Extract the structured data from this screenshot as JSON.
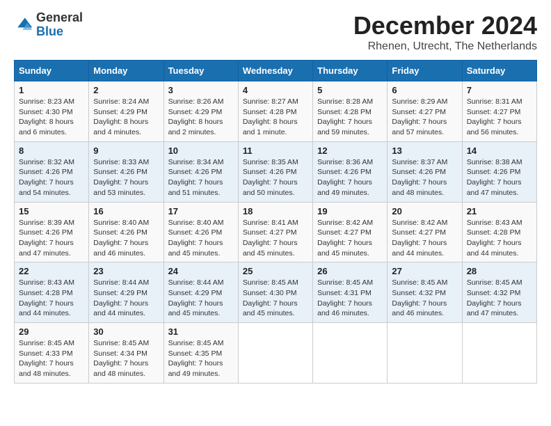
{
  "logo": {
    "text_general": "General",
    "text_blue": "Blue"
  },
  "title": "December 2024",
  "subtitle": "Rhenen, Utrecht, The Netherlands",
  "days_of_week": [
    "Sunday",
    "Monday",
    "Tuesday",
    "Wednesday",
    "Thursday",
    "Friday",
    "Saturday"
  ],
  "weeks": [
    [
      {
        "day": "1",
        "sunrise": "8:23 AM",
        "sunset": "4:30 PM",
        "daylight": "8 hours and 6 minutes."
      },
      {
        "day": "2",
        "sunrise": "8:24 AM",
        "sunset": "4:29 PM",
        "daylight": "8 hours and 4 minutes."
      },
      {
        "day": "3",
        "sunrise": "8:26 AM",
        "sunset": "4:29 PM",
        "daylight": "8 hours and 2 minutes."
      },
      {
        "day": "4",
        "sunrise": "8:27 AM",
        "sunset": "4:28 PM",
        "daylight": "8 hours and 1 minute."
      },
      {
        "day": "5",
        "sunrise": "8:28 AM",
        "sunset": "4:28 PM",
        "daylight": "7 hours and 59 minutes."
      },
      {
        "day": "6",
        "sunrise": "8:29 AM",
        "sunset": "4:27 PM",
        "daylight": "7 hours and 57 minutes."
      },
      {
        "day": "7",
        "sunrise": "8:31 AM",
        "sunset": "4:27 PM",
        "daylight": "7 hours and 56 minutes."
      }
    ],
    [
      {
        "day": "8",
        "sunrise": "8:32 AM",
        "sunset": "4:26 PM",
        "daylight": "7 hours and 54 minutes."
      },
      {
        "day": "9",
        "sunrise": "8:33 AM",
        "sunset": "4:26 PM",
        "daylight": "7 hours and 53 minutes."
      },
      {
        "day": "10",
        "sunrise": "8:34 AM",
        "sunset": "4:26 PM",
        "daylight": "7 hours and 51 minutes."
      },
      {
        "day": "11",
        "sunrise": "8:35 AM",
        "sunset": "4:26 PM",
        "daylight": "7 hours and 50 minutes."
      },
      {
        "day": "12",
        "sunrise": "8:36 AM",
        "sunset": "4:26 PM",
        "daylight": "7 hours and 49 minutes."
      },
      {
        "day": "13",
        "sunrise": "8:37 AM",
        "sunset": "4:26 PM",
        "daylight": "7 hours and 48 minutes."
      },
      {
        "day": "14",
        "sunrise": "8:38 AM",
        "sunset": "4:26 PM",
        "daylight": "7 hours and 47 minutes."
      }
    ],
    [
      {
        "day": "15",
        "sunrise": "8:39 AM",
        "sunset": "4:26 PM",
        "daylight": "7 hours and 47 minutes."
      },
      {
        "day": "16",
        "sunrise": "8:40 AM",
        "sunset": "4:26 PM",
        "daylight": "7 hours and 46 minutes."
      },
      {
        "day": "17",
        "sunrise": "8:40 AM",
        "sunset": "4:26 PM",
        "daylight": "7 hours and 45 minutes."
      },
      {
        "day": "18",
        "sunrise": "8:41 AM",
        "sunset": "4:27 PM",
        "daylight": "7 hours and 45 minutes."
      },
      {
        "day": "19",
        "sunrise": "8:42 AM",
        "sunset": "4:27 PM",
        "daylight": "7 hours and 45 minutes."
      },
      {
        "day": "20",
        "sunrise": "8:42 AM",
        "sunset": "4:27 PM",
        "daylight": "7 hours and 44 minutes."
      },
      {
        "day": "21",
        "sunrise": "8:43 AM",
        "sunset": "4:28 PM",
        "daylight": "7 hours and 44 minutes."
      }
    ],
    [
      {
        "day": "22",
        "sunrise": "8:43 AM",
        "sunset": "4:28 PM",
        "daylight": "7 hours and 44 minutes."
      },
      {
        "day": "23",
        "sunrise": "8:44 AM",
        "sunset": "4:29 PM",
        "daylight": "7 hours and 44 minutes."
      },
      {
        "day": "24",
        "sunrise": "8:44 AM",
        "sunset": "4:29 PM",
        "daylight": "7 hours and 45 minutes."
      },
      {
        "day": "25",
        "sunrise": "8:45 AM",
        "sunset": "4:30 PM",
        "daylight": "7 hours and 45 minutes."
      },
      {
        "day": "26",
        "sunrise": "8:45 AM",
        "sunset": "4:31 PM",
        "daylight": "7 hours and 46 minutes."
      },
      {
        "day": "27",
        "sunrise": "8:45 AM",
        "sunset": "4:32 PM",
        "daylight": "7 hours and 46 minutes."
      },
      {
        "day": "28",
        "sunrise": "8:45 AM",
        "sunset": "4:32 PM",
        "daylight": "7 hours and 47 minutes."
      }
    ],
    [
      {
        "day": "29",
        "sunrise": "8:45 AM",
        "sunset": "4:33 PM",
        "daylight": "7 hours and 48 minutes."
      },
      {
        "day": "30",
        "sunrise": "8:45 AM",
        "sunset": "4:34 PM",
        "daylight": "7 hours and 48 minutes."
      },
      {
        "day": "31",
        "sunrise": "8:45 AM",
        "sunset": "4:35 PM",
        "daylight": "7 hours and 49 minutes."
      },
      null,
      null,
      null,
      null
    ]
  ]
}
